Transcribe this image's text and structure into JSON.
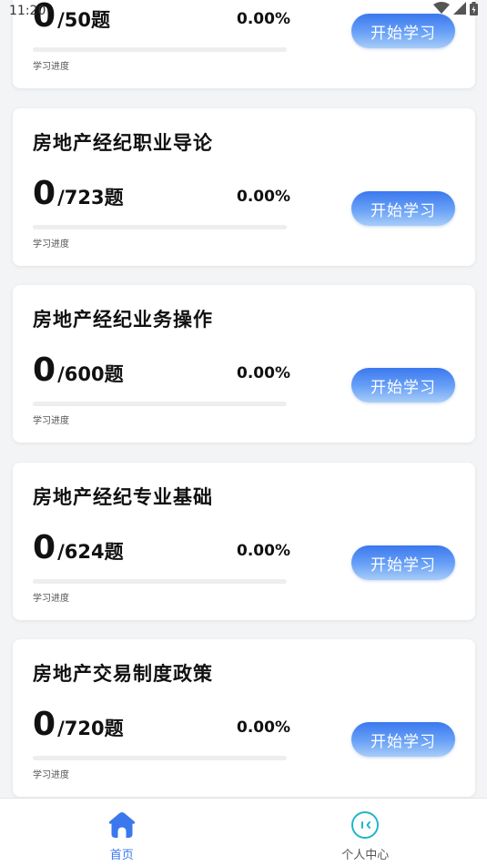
{
  "status_bar": {
    "time": "11:20"
  },
  "courses": [
    {
      "title": "",
      "done": "0",
      "total": "/50",
      "unit": "题",
      "percent": "0.00%",
      "progress": 0,
      "progress_label": "学习进度",
      "button": "开始学习"
    },
    {
      "title": "房地产经纪职业导论",
      "done": "0",
      "total": "/723",
      "unit": "题",
      "percent": "0.00%",
      "progress": 0,
      "progress_label": "学习进度",
      "button": "开始学习"
    },
    {
      "title": "房地产经纪业务操作",
      "done": "0",
      "total": "/600",
      "unit": "题",
      "percent": "0.00%",
      "progress": 0,
      "progress_label": "学习进度",
      "button": "开始学习"
    },
    {
      "title": "房地产经纪专业基础",
      "done": "0",
      "total": "/624",
      "unit": "题",
      "percent": "0.00%",
      "progress": 0,
      "progress_label": "学习进度",
      "button": "开始学习"
    },
    {
      "title": "房地产交易制度政策",
      "done": "0",
      "total": "/720",
      "unit": "题",
      "percent": "0.00%",
      "progress": 0,
      "progress_label": "学习进度",
      "button": "开始学习"
    }
  ],
  "tabbar": {
    "home_label": "首页",
    "profile_label": "个人中心",
    "active_color": "#3b78ee"
  }
}
